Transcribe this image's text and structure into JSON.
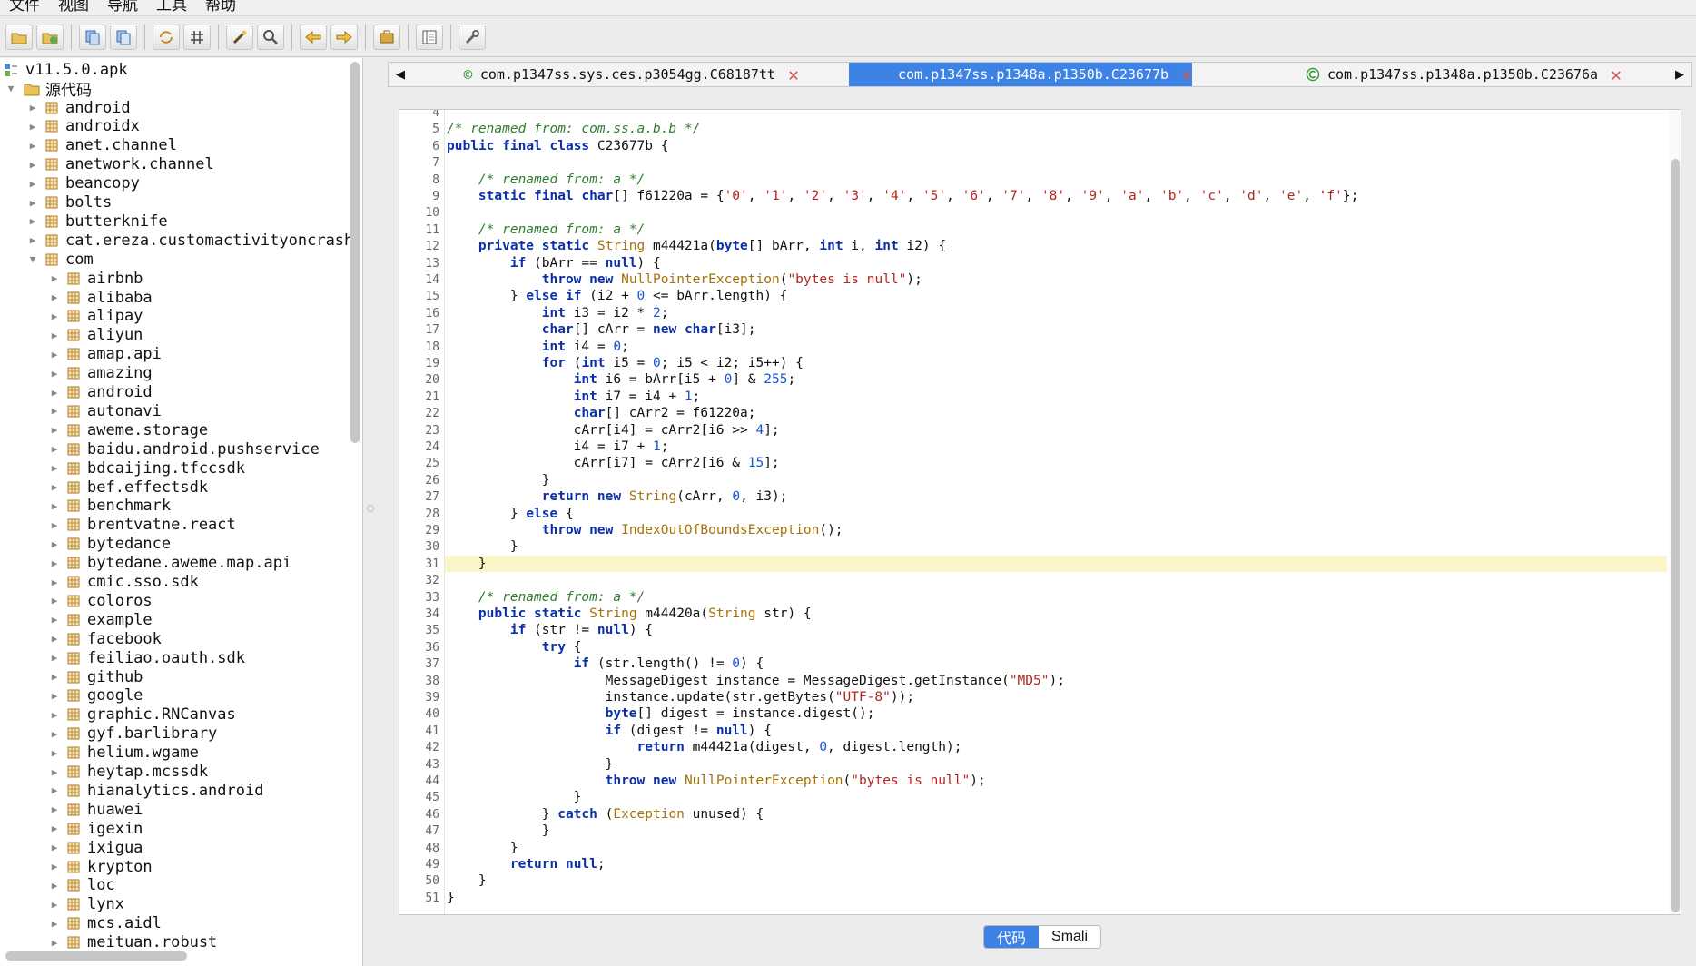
{
  "menu": [
    "文件",
    "视图",
    "导航",
    "工具",
    "帮助"
  ],
  "toolbar_icons": [
    "open-folder-icon",
    "add-file-icon",
    "copy-icon",
    "paste-icon",
    "sync-icon",
    "grid-icon",
    "wand-icon",
    "search-icon",
    "back-arrow-icon",
    "forward-arrow-icon",
    "briefcase-icon",
    "layout-icon",
    "settings-wrench-icon"
  ],
  "tree": {
    "root": "v11.5.0.apk",
    "source": "源代码",
    "top_packages": [
      "android",
      "androidx",
      "anet.channel",
      "anetwork.channel",
      "beancopy",
      "bolts",
      "butterknife",
      "cat.ereza.customactivityoncrash"
    ],
    "com": "com",
    "com_children": [
      "airbnb",
      "alibaba",
      "alipay",
      "aliyun",
      "amap.api",
      "amazing",
      "android",
      "autonavi",
      "aweme.storage",
      "baidu.android.pushservice",
      "bdcaijing.tfccsdk",
      "bef.effectsdk",
      "benchmark",
      "brentvatne.react",
      "bytedance",
      "bytedane.aweme.map.api",
      "cmic.sso.sdk",
      "coloros",
      "example",
      "facebook",
      "feiliao.oauth.sdk",
      "github",
      "google",
      "graphic.RNCanvas",
      "gyf.barlibrary",
      "helium.wgame",
      "heytap.mcssdk",
      "hianalytics.android",
      "huawei",
      "igexin",
      "ixigua",
      "krypton",
      "loc",
      "lynx",
      "mcs.aidl",
      "meituan.robust"
    ]
  },
  "tabs": [
    {
      "label": "com.p1347ss.sys.ces.p3054gg.C68187tt",
      "active": false
    },
    {
      "label": "com.p1347ss.p1348a.p1350b.C23677b",
      "active": true
    },
    {
      "label": "com.p1347ss.p1348a.p1350b.C23676a",
      "active": false
    }
  ],
  "code": {
    "line_numbers": [
      "4",
      "5",
      "6",
      "7",
      "8",
      "9",
      "10",
      "11",
      "12",
      "13",
      "14",
      "15",
      "16",
      "17",
      "18",
      "19",
      "20",
      "21",
      "22",
      "23",
      "24",
      "25",
      "26",
      "27",
      "28",
      "29",
      "30",
      "31",
      "32",
      "33",
      "34",
      "35",
      "36",
      "37",
      "38",
      "39",
      "40",
      "41",
      "42",
      "43",
      "44",
      "45",
      "46",
      "47",
      "48",
      "49",
      "50",
      "51"
    ],
    "highlighted_line": "31",
    "lines": [
      "",
      "/* renamed from: com.ss.a.b.b */",
      "public final class C23677b {",
      "",
      "    /* renamed from: a */",
      "    static final char[] f61220a = {'0', '1', '2', '3', '4', '5', '6', '7', '8', '9', 'a', 'b', 'c', 'd', 'e', 'f'};",
      "",
      "    /* renamed from: a */",
      "    private static String m44421a(byte[] bArr, int i, int i2) {",
      "        if (bArr == null) {",
      "            throw new NullPointerException(\"bytes is null\");",
      "        } else if (i2 + 0 <= bArr.length) {",
      "            int i3 = i2 * 2;",
      "            char[] cArr = new char[i3];",
      "            int i4 = 0;",
      "            for (int i5 = 0; i5 < i2; i5++) {",
      "                int i6 = bArr[i5 + 0] & 255;",
      "                int i7 = i4 + 1;",
      "                char[] cArr2 = f61220a;",
      "                cArr[i4] = cArr2[i6 >> 4];",
      "                i4 = i7 + 1;",
      "                cArr[i7] = cArr2[i6 & 15];",
      "            }",
      "            return new String(cArr, 0, i3);",
      "        } else {",
      "            throw new IndexOutOfBoundsException();",
      "        }",
      "    }",
      "",
      "    /* renamed from: a */",
      "    public static String m44420a(String str) {",
      "        if (str != null) {",
      "            try {",
      "                if (str.length() != 0) {",
      "                    MessageDigest instance = MessageDigest.getInstance(\"MD5\");",
      "                    instance.update(str.getBytes(\"UTF-8\"));",
      "                    byte[] digest = instance.digest();",
      "                    if (digest != null) {",
      "                        return m44421a(digest, 0, digest.length);",
      "                    }",
      "                    throw new NullPointerException(\"bytes is null\");",
      "                }",
      "            } catch (Exception unused) {",
      "            }",
      "        }",
      "        return null;",
      "    }",
      "}"
    ]
  },
  "bottom_toggle": {
    "code_label": "代码",
    "smali_label": "Smali",
    "active": "code"
  },
  "colors": {
    "accent": "#3d83e6",
    "highlight": "#fbf6c8",
    "keyword": "#0b2fa8",
    "comment": "#2f7d2f",
    "string": "#b3261e",
    "close": "#d9534f"
  }
}
